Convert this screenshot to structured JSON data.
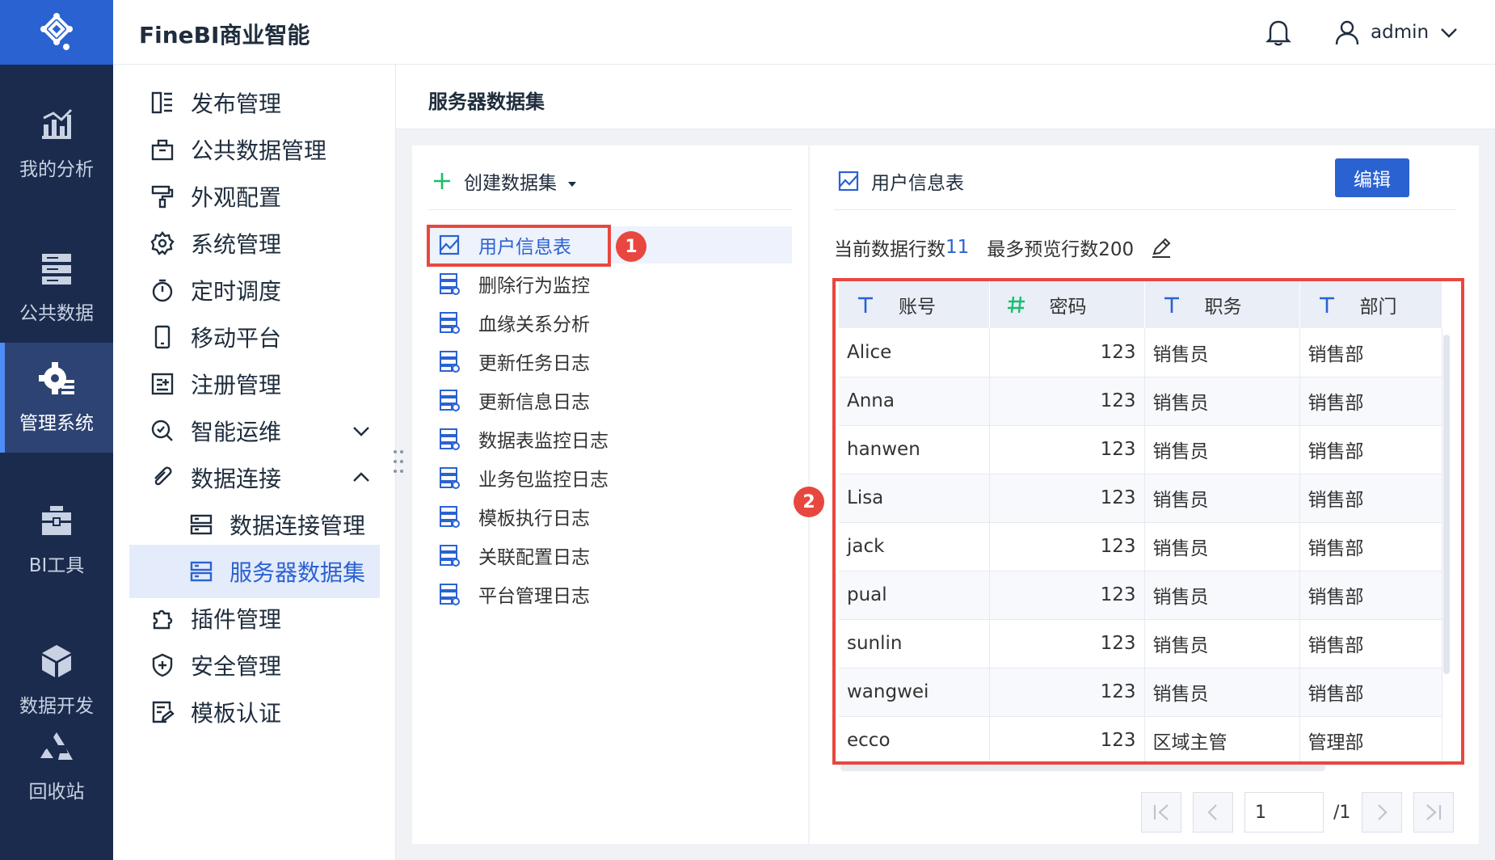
{
  "app": {
    "brand": "FineBI商业智能"
  },
  "colors": {
    "brand_blue": "#2a62d2",
    "rail_bg": "#1a2b4d",
    "highlight_red": "#e8473f",
    "accent_green": "#19be6b"
  },
  "rail": [
    {
      "label": "我的分析",
      "icon": "bar-chart-icon"
    },
    {
      "label": "公共数据",
      "icon": "database-icon"
    },
    {
      "label": "管理系统",
      "icon": "gear-icon",
      "active": true
    },
    {
      "label": "BI工具",
      "icon": "toolbox-icon"
    },
    {
      "label": "数据开发",
      "icon": "cube-icon"
    },
    {
      "label": "回收站",
      "icon": "recycle-icon"
    }
  ],
  "header": {
    "username": "admin"
  },
  "menu": [
    {
      "label": "发布管理",
      "icon": "publish-icon"
    },
    {
      "label": "公共数据管理",
      "icon": "briefcase-icon"
    },
    {
      "label": "外观配置",
      "icon": "paint-roller-icon"
    },
    {
      "label": "系统管理",
      "icon": "gear-icon"
    },
    {
      "label": "定时调度",
      "icon": "stopwatch-icon"
    },
    {
      "label": "移动平台",
      "icon": "mobile-icon"
    },
    {
      "label": "注册管理",
      "icon": "register-icon"
    },
    {
      "label": "智能运维",
      "icon": "ops-icon",
      "caret": "down"
    },
    {
      "label": "数据连接",
      "icon": "link-icon",
      "caret": "up"
    },
    {
      "label": "数据连接管理",
      "icon": "server-icon",
      "sub": true
    },
    {
      "label": "服务器数据集",
      "icon": "dataset-icon",
      "sub": true,
      "selected": true
    },
    {
      "label": "插件管理",
      "icon": "puzzle-icon"
    },
    {
      "label": "安全管理",
      "icon": "shield-icon"
    },
    {
      "label": "模板认证",
      "icon": "certificate-icon"
    }
  ],
  "page": {
    "title": "服务器数据集"
  },
  "dataset_list": {
    "create_label": "创建数据集",
    "items": [
      {
        "label": "用户信息表",
        "icon": "table-chart-icon",
        "selected": true
      },
      {
        "label": "删除行为监控",
        "icon": "db-table-icon"
      },
      {
        "label": "血缘关系分析",
        "icon": "db-table-icon"
      },
      {
        "label": "更新任务日志",
        "icon": "db-table-icon"
      },
      {
        "label": "更新信息日志",
        "icon": "db-table-icon"
      },
      {
        "label": "数据表监控日志",
        "icon": "db-table-icon"
      },
      {
        "label": "业务包监控日志",
        "icon": "db-table-icon"
      },
      {
        "label": "模板执行日志",
        "icon": "db-table-icon"
      },
      {
        "label": "关联配置日志",
        "icon": "db-table-icon"
      },
      {
        "label": "平台管理日志",
        "icon": "db-table-icon"
      }
    ]
  },
  "annotations": {
    "badge1": "1",
    "badge2": "2"
  },
  "preview": {
    "title": "用户信息表",
    "edit_label": "编辑",
    "row_count_label": "当前数据行数",
    "row_count": "11",
    "max_preview_label": "最多预览行数200",
    "columns": [
      {
        "name": "账号",
        "type": "text"
      },
      {
        "name": "密码",
        "type": "number"
      },
      {
        "name": "职务",
        "type": "text"
      },
      {
        "name": "部门",
        "type": "text"
      }
    ],
    "rows": [
      [
        "Alice",
        "123",
        "销售员",
        "销售部"
      ],
      [
        "Anna",
        "123",
        "销售员",
        "销售部"
      ],
      [
        "hanwen",
        "123",
        "销售员",
        "销售部"
      ],
      [
        "Lisa",
        "123",
        "销售员",
        "销售部"
      ],
      [
        "jack",
        "123",
        "销售员",
        "销售部"
      ],
      [
        "pual",
        "123",
        "销售员",
        "销售部"
      ],
      [
        "sunlin",
        "123",
        "销售员",
        "销售部"
      ],
      [
        "wangwei",
        "123",
        "销售员",
        "销售部"
      ],
      [
        "ecco",
        "123",
        "区域主管",
        "管理部"
      ]
    ]
  },
  "pager": {
    "current": "1",
    "total": "/1"
  }
}
